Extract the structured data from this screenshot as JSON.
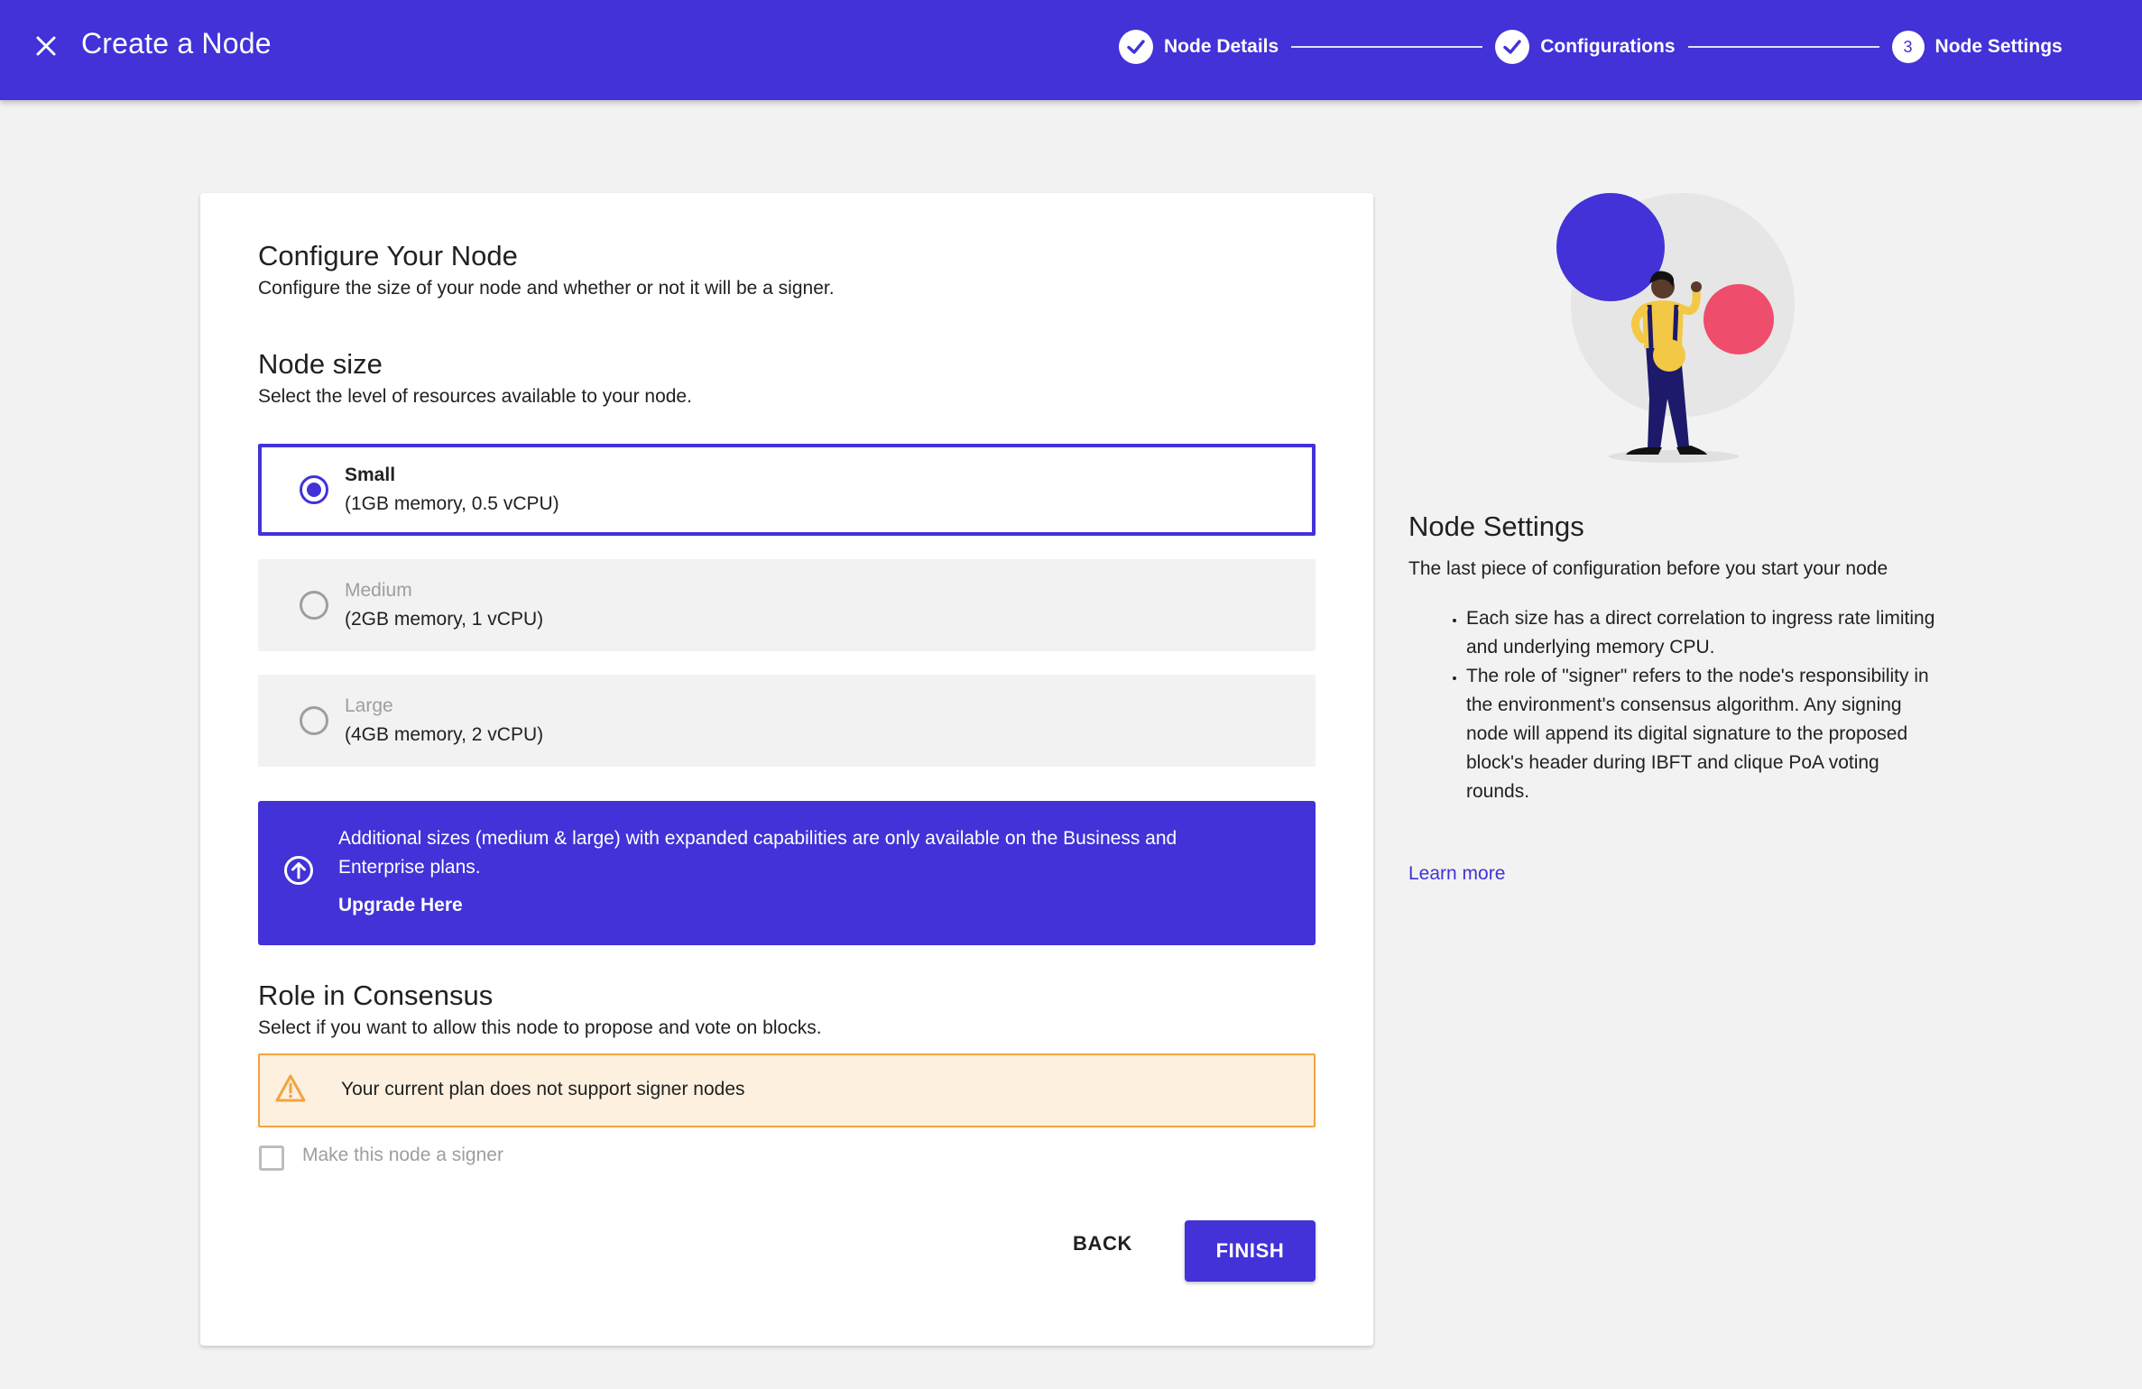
{
  "header": {
    "title": "Create a Node",
    "steps": [
      {
        "label": "Node Details",
        "state": "complete"
      },
      {
        "label": "Configurations",
        "state": "complete"
      },
      {
        "label": "Node Settings",
        "state": "current",
        "number": "3"
      }
    ]
  },
  "configure": {
    "title": "Configure Your Node",
    "subtitle": "Configure the size of your node and whether or not it will be a signer."
  },
  "node_size": {
    "title": "Node size",
    "subtitle": "Select the level of resources available to your node.",
    "options": [
      {
        "name": "Small",
        "desc": "(1GB memory, 0.5 vCPU)",
        "selected": true
      },
      {
        "name": "Medium",
        "desc": "(2GB memory, 1 vCPU)",
        "selected": false
      },
      {
        "name": "Large",
        "desc": "(4GB memory, 2 vCPU)",
        "selected": false
      }
    ]
  },
  "upgrade": {
    "text": "Additional sizes (medium & large) with expanded capabilities are only available on the Business and Enterprise plans.",
    "link": "Upgrade Here"
  },
  "consensus": {
    "title": "Role in Consensus",
    "subtitle": "Select if you want to allow this node to propose and vote on blocks.",
    "warning": "Your current plan does not support signer nodes",
    "checkbox_label": "Make this node a signer"
  },
  "actions": {
    "back": "BACK",
    "finish": "FINISH"
  },
  "info": {
    "title": "Node Settings",
    "subtitle": "The last piece of configuration before you start your node",
    "bullets": [
      "Each size has a direct correlation to ingress rate limiting and underlying memory CPU.",
      "The role of \"signer\" refers to the node's responsibility in the environment's consensus algorithm. Any signing node will append its digital signature to the proposed block's header during IBFT and clique PoA voting rounds."
    ],
    "learn_more": "Learn more"
  },
  "colors": {
    "accent": "#4232d8",
    "warning_bg": "#fdf0df",
    "warning_border": "#f2a341",
    "illustration_red": "#ee4d6b",
    "illustration_yellow": "#f3c844"
  }
}
